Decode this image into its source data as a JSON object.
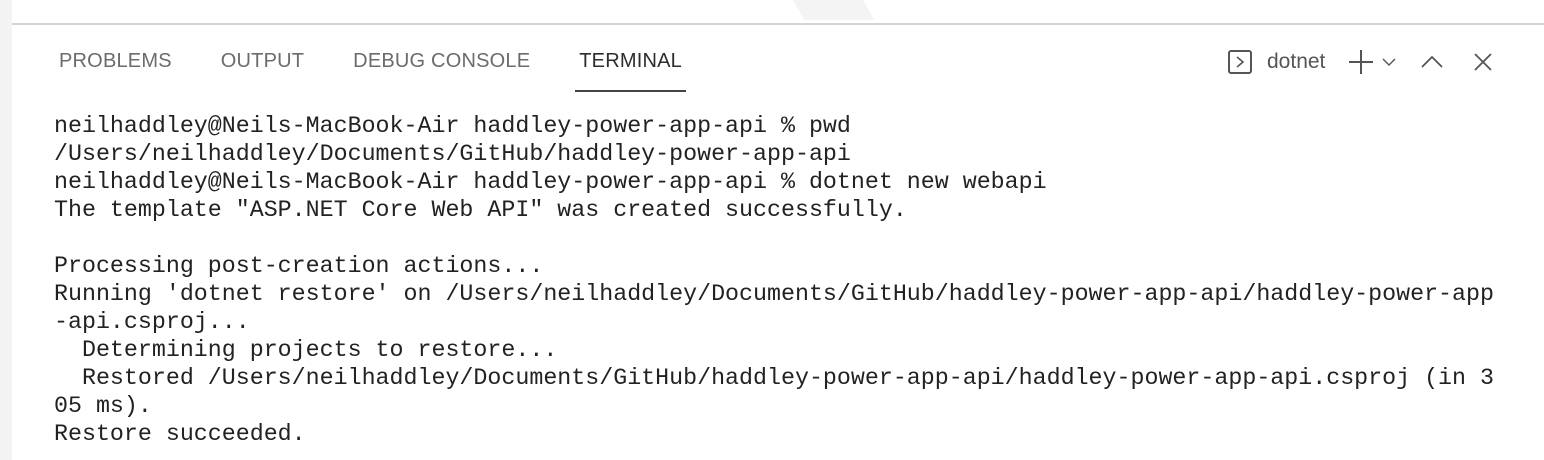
{
  "panel": {
    "tabs": [
      {
        "label": "PROBLEMS",
        "active": false
      },
      {
        "label": "OUTPUT",
        "active": false
      },
      {
        "label": "DEBUG CONSOLE",
        "active": false
      },
      {
        "label": "TERMINAL",
        "active": true
      }
    ],
    "terminal_name": "dotnet"
  },
  "terminal": {
    "lines": [
      "neilhaddley@Neils-MacBook-Air haddley-power-app-api % pwd",
      "/Users/neilhaddley/Documents/GitHub/haddley-power-app-api",
      "neilhaddley@Neils-MacBook-Air haddley-power-app-api % dotnet new webapi",
      "The template \"ASP.NET Core Web API\" was created successfully.",
      "",
      "Processing post-creation actions...",
      "Running 'dotnet restore' on /Users/neilhaddley/Documents/GitHub/haddley-power-app-api/haddley-power-app",
      "-api.csproj...",
      "  Determining projects to restore...",
      "  Restored /Users/neilhaddley/Documents/GitHub/haddley-power-app-api/haddley-power-app-api.csproj (in 3",
      "05 ms).",
      "Restore succeeded."
    ]
  }
}
